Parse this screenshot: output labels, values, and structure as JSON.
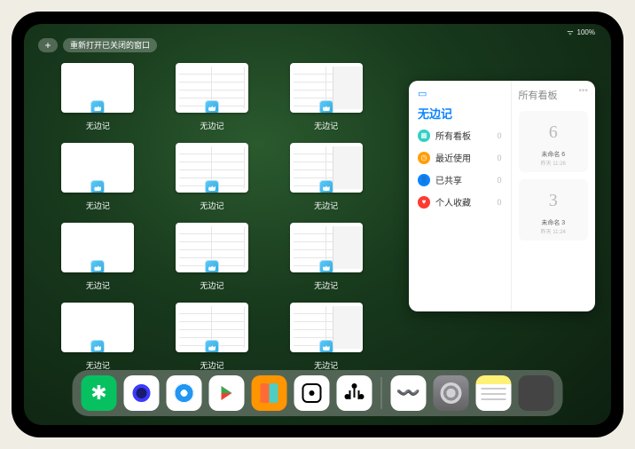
{
  "status": {
    "wifi": "wifi-icon",
    "battery": "100%"
  },
  "controls": {
    "plus": "+",
    "reopen": "重新打开已关闭的窗口"
  },
  "app_name": "无边记",
  "windows": [
    {
      "label": "无边记",
      "type": "blank"
    },
    {
      "label": "无边记",
      "type": "grid"
    },
    {
      "label": "无边记",
      "type": "grid-overlay"
    },
    {
      "label": "无边记",
      "type": "blank"
    },
    {
      "label": "无边记",
      "type": "grid"
    },
    {
      "label": "无边记",
      "type": "grid-overlay"
    },
    {
      "label": "无边记",
      "type": "blank"
    },
    {
      "label": "无边记",
      "type": "grid"
    },
    {
      "label": "无边记",
      "type": "grid-overlay"
    },
    {
      "label": "无边记",
      "type": "blank"
    },
    {
      "label": "无边记",
      "type": "grid"
    },
    {
      "label": "无边记",
      "type": "grid-overlay"
    }
  ],
  "panel": {
    "title": "无边记",
    "right_title": "所有看板",
    "categories": [
      {
        "icon": "all",
        "label": "所有看板",
        "count": 0
      },
      {
        "icon": "recent",
        "label": "最近使用",
        "count": 0
      },
      {
        "icon": "shared",
        "label": "已共享",
        "count": 0
      },
      {
        "icon": "fav",
        "label": "个人收藏",
        "count": 0
      }
    ],
    "boards": [
      {
        "sketch": "6",
        "name": "未命名 6",
        "time": "昨天 11:26"
      },
      {
        "sketch": "3",
        "name": "未命名 3",
        "time": "昨天 11:24"
      }
    ]
  },
  "dock": [
    {
      "name": "wechat"
    },
    {
      "name": "quark"
    },
    {
      "name": "browser"
    },
    {
      "name": "play"
    },
    {
      "name": "books"
    },
    {
      "name": "dice"
    },
    {
      "name": "node"
    },
    {
      "name": "sep"
    },
    {
      "name": "freeform"
    },
    {
      "name": "settings"
    },
    {
      "name": "notes"
    },
    {
      "name": "multi"
    }
  ]
}
